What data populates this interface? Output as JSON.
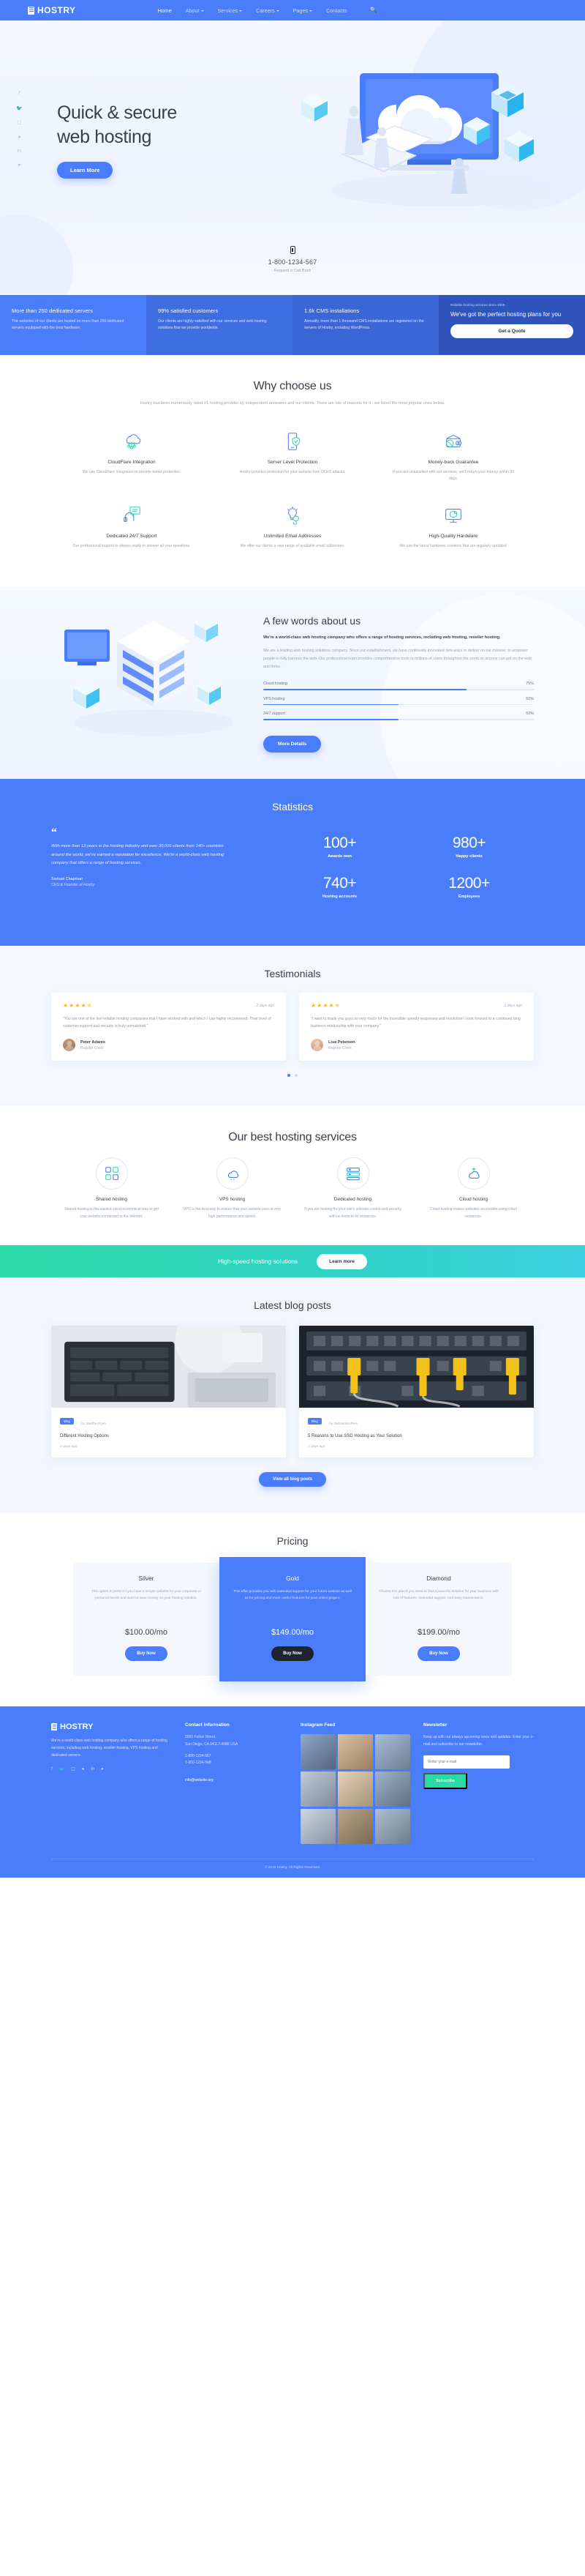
{
  "brand": {
    "name": "HOSTRY"
  },
  "nav": {
    "items": [
      {
        "label": "Home",
        "active": true,
        "caret": false
      },
      {
        "label": "About",
        "active": false,
        "caret": true
      },
      {
        "label": "Services",
        "active": false,
        "caret": true
      },
      {
        "label": "Careers",
        "active": false,
        "caret": true
      },
      {
        "label": "Pages",
        "active": false,
        "caret": true
      },
      {
        "label": "Contacts",
        "active": false,
        "caret": false
      }
    ],
    "search_icon": "search-icon"
  },
  "hero": {
    "title_line1": "Quick & secure",
    "title_line2": "web hosting",
    "cta": "Learn More",
    "phone": "1-800-1234-567",
    "phone_sub": "Request a Call Back",
    "social": [
      "f",
      "t",
      "ig",
      "g",
      "in",
      "p"
    ]
  },
  "statsbar": {
    "cards": [
      {
        "title": "More than 250 dedicated servers",
        "text": "The websites of our clients are hosted on more than 250 dedicated servers equipped with the best hardware."
      },
      {
        "title": "99% satisfied customers",
        "text": "Our clients are highly satisfied with our services and web hosting solutions that we provide worldwide."
      },
      {
        "title": "1.6k CMS installations",
        "text": "Annually, more than 1 thousand CMS installations are registered on the servers of Hostry, including WordPress."
      }
    ],
    "promo": {
      "eyebrow": "Reliable hosting services since 2005",
      "title": "We've got the perfect hosting plans for you",
      "button": "Get a Quote"
    }
  },
  "why": {
    "title": "Why choose us",
    "subtitle": "Hostry has been numerously rated #1 hosting provider by independent reviewers and our clients. There are lots of reasons for it - we listed the most popular ones below.",
    "features": [
      {
        "icon": "cloud-network-icon",
        "title": "CloudFlare Integration",
        "text": "We use CloudFlare integration to provide better protection."
      },
      {
        "icon": "phone-shield-icon",
        "title": "Server Level Protection",
        "text": "Hostry provides protection for your website from DDoS attacks."
      },
      {
        "icon": "wallet-icon",
        "title": "Money-back Guarantee",
        "text": "If you are unsatisfied with our services, we'll return your money within 30 days."
      },
      {
        "icon": "support-headset-icon",
        "title": "Dedicated 24/7 Support",
        "text": "Our professional support is always ready to answer all your questions."
      },
      {
        "icon": "lightbulb-icon",
        "title": "Unlimited Email Addresses",
        "text": "We offer our clients a vast range of available email addresses."
      },
      {
        "icon": "monitor-shield-icon",
        "title": "High-Quality Hardware",
        "text": "We use the latest hardware solutions that are regularly updated."
      }
    ]
  },
  "about": {
    "title": "A few words about us",
    "lead": "We're a world-class web hosting company who offers a range of hosting services, including web hosting, reseller hosting.",
    "body": "We are a leading web hosting solutions company. Since our establishment, we have continually innovated new ways to deliver on our mission: to empower people to fully harness the web. Our professional team provides comprehensive tools to millions of users throughout the world so anyone can get on the web and thrive.",
    "skills": [
      {
        "label": "Cloud hosting",
        "value": "75%",
        "pct": 75
      },
      {
        "label": "VPS hosting",
        "value": "50%",
        "pct": 50
      },
      {
        "label": "24/7 support",
        "value": "50%",
        "pct": 50
      }
    ],
    "button": "More Details"
  },
  "statistics": {
    "title": "Statistics",
    "quote_mark": "“",
    "quote": "With more than 13 years in the hosting industry and over 30,000 clients from 140+ countries around the world, we've earned a reputation for excellence. We're a world-class web hosting company that offers a range of hosting services.",
    "author": "Samuel Chapman",
    "role": "CEO & Founder of Hostry",
    "counters": [
      {
        "num": "100+",
        "label": "Awards won"
      },
      {
        "num": "980+",
        "label": "Happy clients"
      },
      {
        "num": "740+",
        "label": "Hosting accounts"
      },
      {
        "num": "1200+",
        "label": "Employees"
      }
    ]
  },
  "testimonials": {
    "title": "Testimonials",
    "items": [
      {
        "stars": "★★★★✯",
        "ago": "2 days ago",
        "text": "\"You are one of the few reliable hosting companies that I have worked with and which I can highly recommend. Their level of customer support and security is truly unmatched.\"",
        "name": "Peter Adams",
        "role": "Regular Client"
      },
      {
        "stars": "★★★★✯",
        "ago": "2 days ago",
        "text": "\"I want to thank you guys so very much for the incredible speedy responses and resolution! I look forward to a continued long business relationship with your company.\"",
        "name": "Lisa Peterson",
        "role": "Regular Client"
      }
    ],
    "dots": 2,
    "active_dot": 0
  },
  "services": {
    "title": "Our best hosting services",
    "items": [
      {
        "icon": "shared-hosting-icon",
        "title": "Shared hosting",
        "text": "Shared hosting is the easiest, most economical way to get your website connected to the Internet."
      },
      {
        "icon": "vps-hosting-icon",
        "title": "VPS hosting",
        "text": "VPS is the best way to ensure that your website runs at very high performance and speed."
      },
      {
        "icon": "dedicated-hosting-icon",
        "title": "Dedicated hosting",
        "text": "If you are looking for your site's ultimate control and security with no limits to its resources."
      },
      {
        "icon": "cloud-hosting-icon",
        "title": "Cloud hosting",
        "text": "Cloud hosting makes websites accessible using cloud resources."
      }
    ]
  },
  "cta": {
    "text": "High-speed hosting solutions",
    "button": "Learn more"
  },
  "blog": {
    "title": "Latest blog posts",
    "button": "View all blog posts",
    "posts": [
      {
        "tag": "Blog",
        "author": "by Martha Ryan",
        "title": "Different Hosting Options",
        "date": "2 days ago",
        "img": "laptop-keyboard-photo"
      },
      {
        "tag": "Blog",
        "author": "by Sebastian Reis",
        "title": "5 Reasons to Use SSD Hosting as Your Solution",
        "date": "2 days ago",
        "img": "server-cables-photo"
      }
    ]
  },
  "pricing": {
    "title": "Pricing",
    "plans": [
      {
        "name": "Silver",
        "text": "This option is perfect if you have a simple website for your corporate or personal needs and want to save money on your hosting solution.",
        "price": "$100.00/mo",
        "button": "Buy Now",
        "featured": false
      },
      {
        "name": "Gold",
        "text": "This offer provides you with extended support for your future website as well as for pricing and more useful features for your online project.",
        "price": "$149.00/mo",
        "button": "Buy Now",
        "featured": true
      },
      {
        "name": "Diamond",
        "text": "Choose this plan if you need to find a powerful solution for your business with lots of features, extended support, and easy maintenance.",
        "price": "$199.00/mo",
        "button": "Buy Now",
        "featured": false
      }
    ]
  },
  "footer": {
    "about": "We're a world-class web hosting company who offers a range of hosting services, including web hosting, reseller hosting, VPS hosting and dedicated servers.",
    "social": [
      "f",
      "t",
      "ig",
      "g",
      "in",
      "p"
    ],
    "contact": {
      "heading": "Contact Information",
      "address1": "2550 Fulton Street,",
      "address2": "San Diego, CA 94117-4088 USA",
      "phone1": "1-800-1234-567",
      "phone2": "1-800-1234-568",
      "email": "info@website.org"
    },
    "instagram": {
      "heading": "Instagram Feed"
    },
    "newsletter": {
      "heading": "Newsletter",
      "text": "Keep up with our always upcoming news and updates. Enter your e-mail and subscribe to our newsletter.",
      "placeholder": "Enter your e-mail",
      "value": "",
      "button": "Subscribe"
    },
    "copyright": "© 2019 Hostry. All Rights Reserved."
  },
  "colors": {
    "accent": "#4a7dfb",
    "accent_dark": "#2f55bd",
    "mint": "#2bd9a6",
    "star": "#ffb41f"
  }
}
